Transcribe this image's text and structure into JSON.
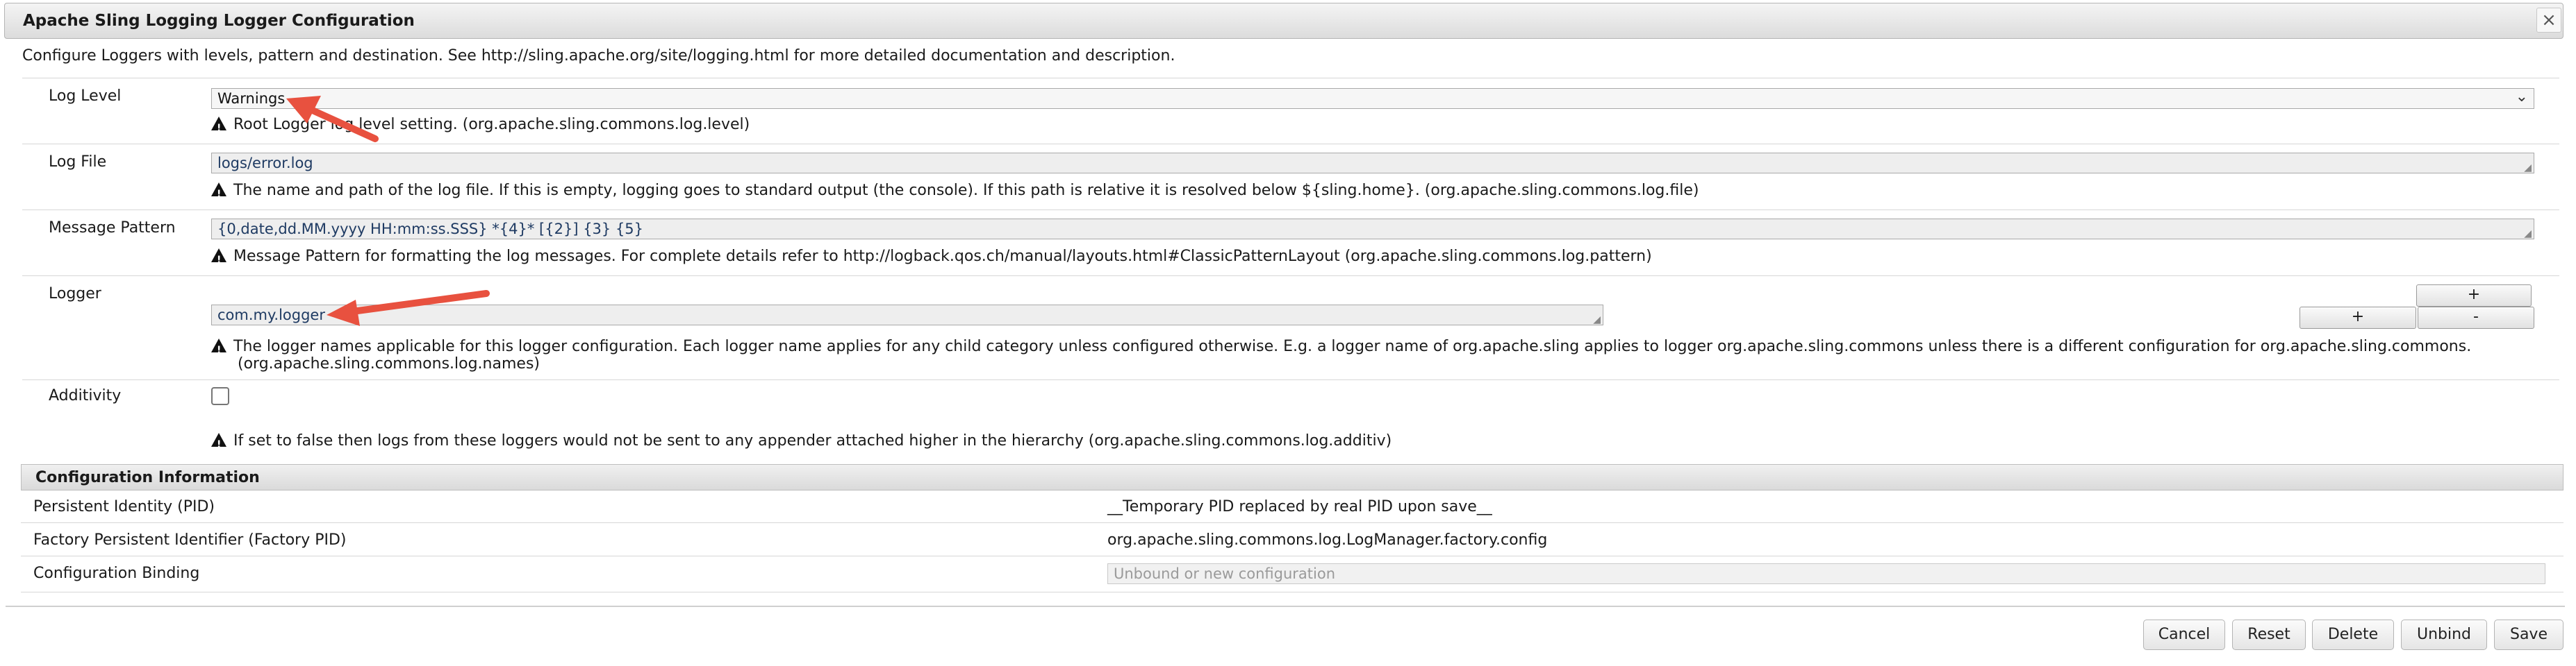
{
  "window": {
    "title": "Apache Sling Logging Logger Configuration",
    "close_symbol": "×"
  },
  "description": "Configure Loggers with levels, pattern and destination. See http://sling.apache.org/site/logging.html for more detailed documentation and description.",
  "fields": {
    "log_level": {
      "label": "Log Level",
      "value": "Warnings",
      "help": "Root Logger log level setting. (org.apache.sling.commons.log.level)"
    },
    "log_file": {
      "label": "Log File",
      "value": "logs/error.log",
      "help": "The name and path of the log file. If this is empty, logging goes to standard output (the console). If this path is relative it is resolved below ${sling.home}. (org.apache.sling.commons.log.file)"
    },
    "message_pattern": {
      "label": "Message Pattern",
      "value": "{0,date,dd.MM.yyyy HH:mm:ss.SSS} *{4}* [{2}] {3} {5}",
      "help": "Message Pattern for formatting the log messages. For complete details refer to http://logback.qos.ch/manual/layouts.html#ClassicPatternLayout (org.apache.sling.commons.log.pattern)"
    },
    "logger": {
      "label": "Logger",
      "value": "com.my.logger",
      "help_line1": "The logger names applicable for this logger configuration. Each logger name applies for any child category unless configured otherwise. E.g. a logger name of org.apache.sling applies to logger org.apache.sling.commons unless there is a different configuration for org.apache.sling.commons.",
      "help_line2": "(org.apache.sling.commons.log.names)",
      "add_label": "+",
      "remove_label": "-"
    },
    "additivity": {
      "label": "Additivity",
      "checked": false,
      "help": "If set to false then logs from these loggers would not be sent to any appender attached higher in the hierarchy (org.apache.sling.commons.log.additiv)"
    }
  },
  "config_info": {
    "heading": "Configuration Information",
    "rows": [
      {
        "label": "Persistent Identity (PID)",
        "value": "__Temporary PID replaced by real PID upon save__"
      },
      {
        "label": "Factory Persistent Identifier (Factory PID)",
        "value": "org.apache.sling.commons.log.LogManager.factory.config"
      },
      {
        "label": "Configuration Binding",
        "placeholder": "Unbound or new configuration"
      }
    ]
  },
  "footer": {
    "cancel": "Cancel",
    "reset": "Reset",
    "delete": "Delete",
    "unbind": "Unbind",
    "save": "Save"
  },
  "annotation_color": "#e8513f"
}
